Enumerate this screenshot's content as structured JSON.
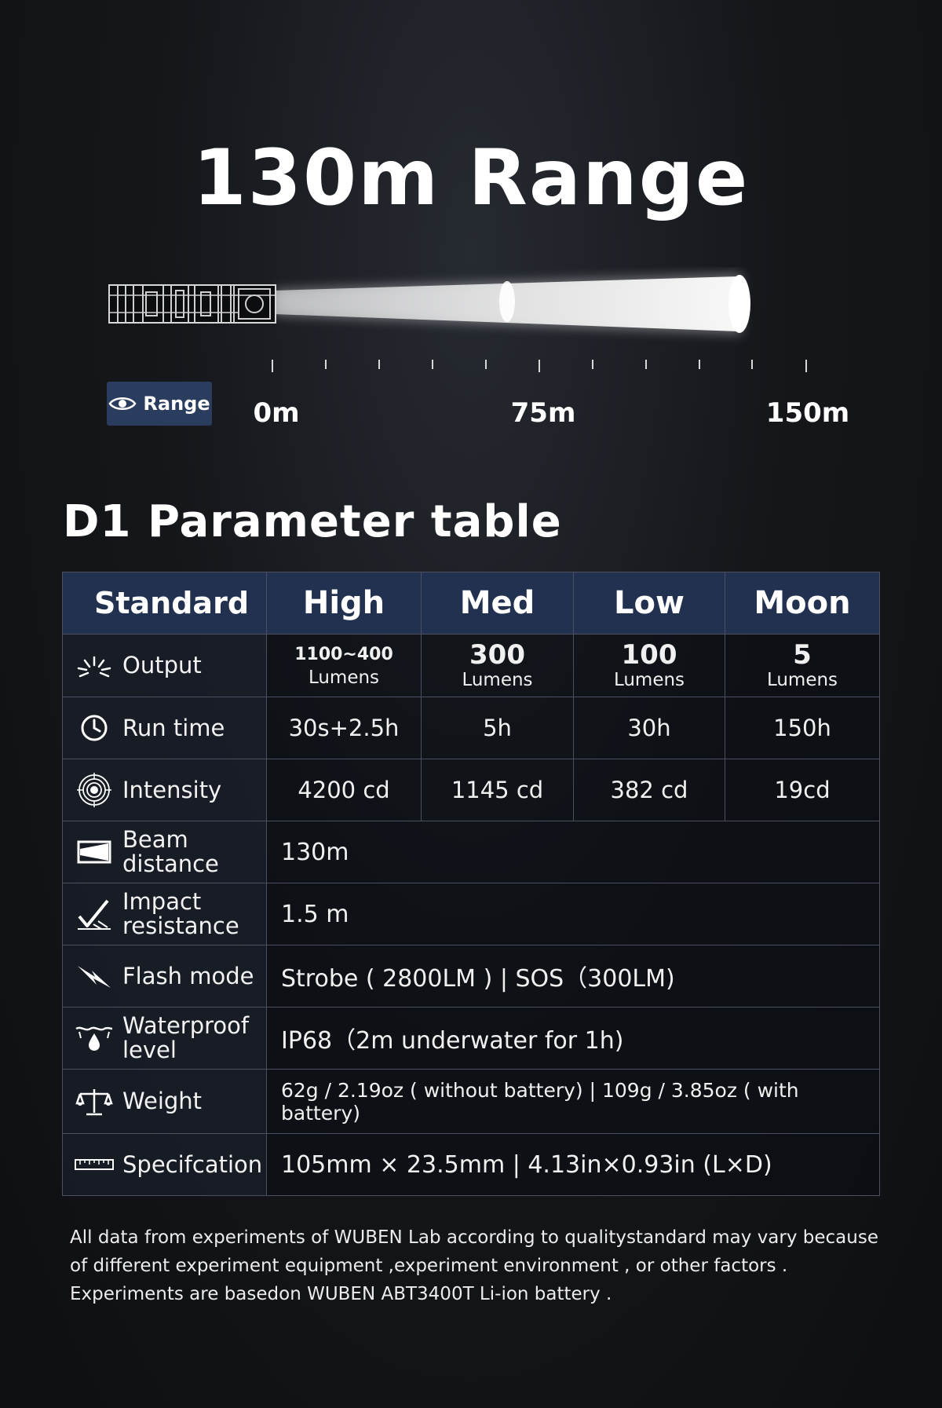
{
  "hero": {
    "title": "130m Range"
  },
  "range_scale": {
    "badge_label": "Range",
    "badge_icon": "eye-icon",
    "labels": [
      "0m",
      "75m",
      "150m"
    ]
  },
  "table": {
    "title": "D1 Parameter table",
    "headers": [
      "Standard",
      "High",
      "Med",
      "Low",
      "Moon"
    ],
    "output": {
      "label": "Output",
      "icon": "burst-icon",
      "values": [
        {
          "num": "1100~400",
          "unit": "Lumens"
        },
        {
          "num": "300",
          "unit": "Lumens"
        },
        {
          "num": "100",
          "unit": "Lumens"
        },
        {
          "num": "5",
          "unit": "Lumens"
        }
      ]
    },
    "runtime": {
      "label": "Run time",
      "icon": "clock-icon",
      "values": [
        "30s+2.5h",
        "5h",
        "30h",
        "150h"
      ]
    },
    "intensity": {
      "label": "Intensity",
      "icon": "target-icon",
      "values": [
        "4200 cd",
        "1145 cd",
        "382 cd",
        "19cd"
      ]
    },
    "beam": {
      "label": "Beam\ndistance",
      "icon": "beam-icon",
      "value": "130m"
    },
    "impact": {
      "label": "Impact\nresistance",
      "icon": "impact-icon",
      "value": "1.5 m"
    },
    "flash": {
      "label": "Flash mode",
      "icon": "lightning-icon",
      "value": "Strobe ( 2800LM ) | SOS（300LM)"
    },
    "waterproof": {
      "label": "Waterproof\nlevel",
      "icon": "water-drop-icon",
      "value": "IP68（2m underwater for 1h)"
    },
    "weight": {
      "label": "Weight",
      "icon": "scale-icon",
      "value": "62g / 2.19oz ( without battery) | 109g / 3.85oz ( with battery)"
    },
    "spec": {
      "label": "Specifcation",
      "icon": "ruler-icon",
      "value": "105mm × 23.5mm | 4.13in×0.93in (L×D)"
    }
  },
  "footnote": [
    "All data from experiments of WUBEN Lab according to qualitystandard may vary because",
    "of different experiment equipment ,experiment environment , or other factors .",
    "Experiments are basedon WUBEN ABT3400T Li-ion battery ."
  ]
}
